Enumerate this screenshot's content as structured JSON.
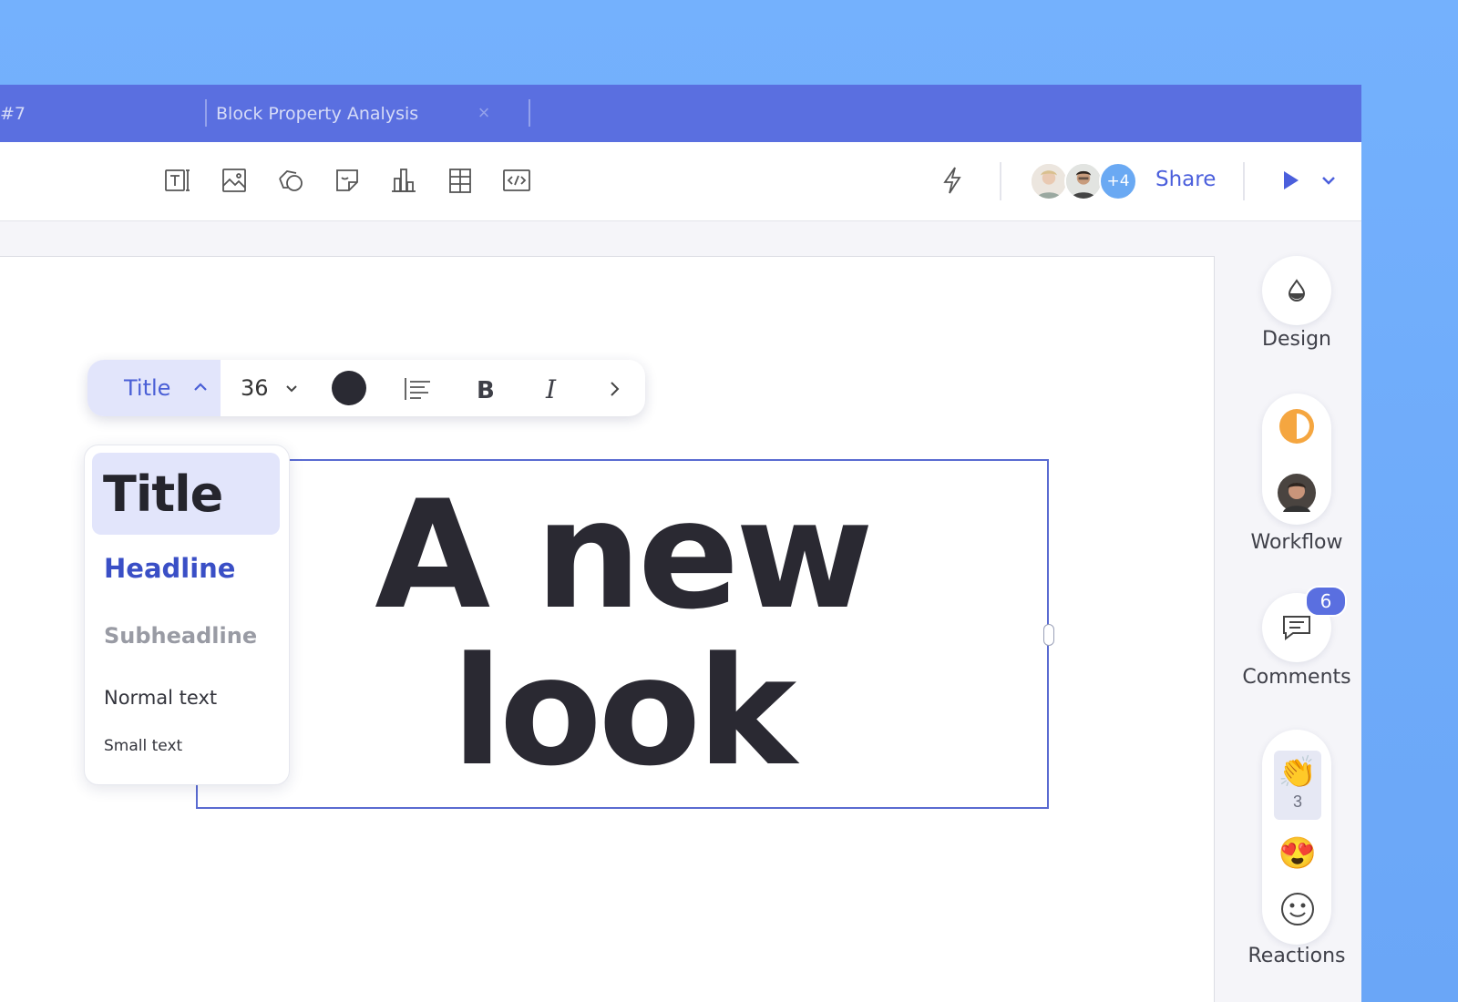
{
  "tabs": [
    {
      "label": "#7"
    },
    {
      "label": "Block Property Analysis",
      "close": "×"
    }
  ],
  "toolbar": {
    "tools": [
      "text-tool-icon",
      "image-tool-icon",
      "shape-tool-icon",
      "sticker-tool-icon",
      "chart-tool-icon",
      "table-tool-icon",
      "embed-tool-icon"
    ],
    "more_collaborators": "+4",
    "share_label": "Share"
  },
  "format_bar": {
    "style": "Title",
    "size": "36",
    "color": "#2a2a33"
  },
  "style_menu": {
    "title": "Title",
    "headline": "Headline",
    "subheadline": "Subheadline",
    "normal": "Normal text",
    "small": "Small text"
  },
  "textbox": {
    "line1": "A new",
    "line2": "look"
  },
  "sidebar": {
    "design": "Design",
    "workflow": "Workflow",
    "comments": "Comments",
    "comments_badge": "6",
    "reactions": "Reactions",
    "clap_count": "3",
    "clap_emoji": "👏",
    "love_emoji": "😍"
  },
  "colors": {
    "accent": "#5a6fe0",
    "text": "#2a2932"
  }
}
